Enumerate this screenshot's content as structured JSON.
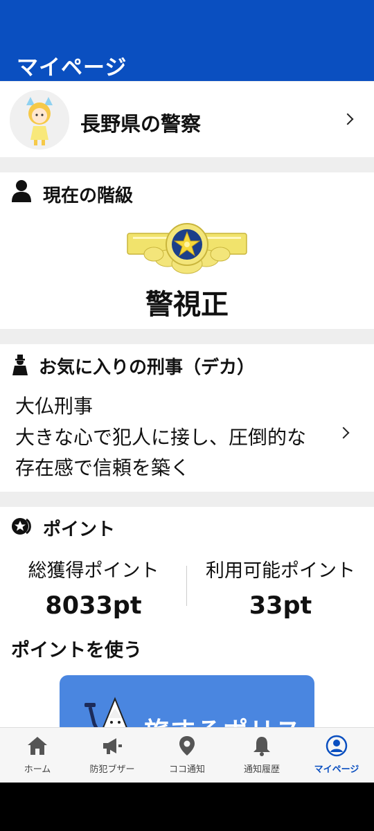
{
  "header": {
    "title": "マイページ"
  },
  "station": {
    "name": "長野県の警察"
  },
  "rank": {
    "section_title": "現在の階級",
    "name": "警視正"
  },
  "favorite": {
    "section_title": "お気に入りの刑事（デカ）",
    "lines": [
      "大仏刑事",
      "大きな心で犯人に接し、圧倒的な",
      "存在感で信頼を築く"
    ]
  },
  "points": {
    "section_title": "ポイント",
    "total_label": "総獲得ポイント",
    "total_value": "8033pt",
    "available_label": "利用可能ポイント",
    "available_value": "33pt",
    "use_title": "ポイントを使う",
    "banner_text": "旅するポリス"
  },
  "nav": {
    "items": [
      {
        "label": "ホーム",
        "icon": "home-icon"
      },
      {
        "label": "防犯ブザー",
        "icon": "megaphone-icon"
      },
      {
        "label": "ココ通知",
        "icon": "location-pin-icon"
      },
      {
        "label": "通知履歴",
        "icon": "bell-icon"
      },
      {
        "label": "マイページ",
        "icon": "account-icon",
        "active": true
      }
    ]
  },
  "colors": {
    "brand_blue": "#0a4fc0",
    "badge_gold": "#f1e36c",
    "banner_blue": "#4a86e0"
  }
}
